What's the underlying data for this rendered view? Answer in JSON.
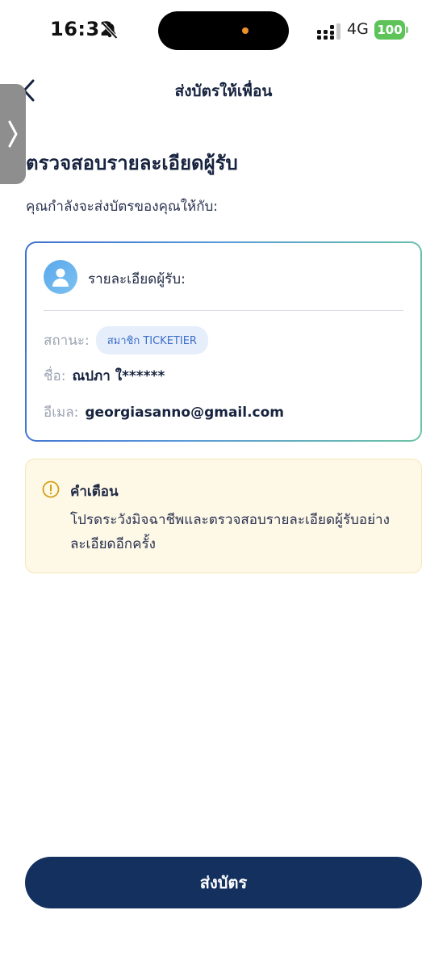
{
  "status_bar": {
    "time": "16:32",
    "network": "4G",
    "battery": "100",
    "icons": [
      "bell-muted-icon",
      "signal-icon",
      "battery-icon"
    ],
    "battery_color": "#5ec45a"
  },
  "header": {
    "title": "ส่งบัตรให้เพื่อน",
    "back_icon": "chevron-left-icon"
  },
  "side_handle": {
    "icon": "chevron-right-icon"
  },
  "main": {
    "heading": "ตรวจสอบรายละเอียดผู้รับ",
    "subtitle": "คุณกำลังจะส่งบัตรของคุณให้กับ:"
  },
  "recipient_card": {
    "title": "รายละเอียดผู้รับ:",
    "avatar_icon": "user-avatar-icon",
    "status_label": "สถานะ:",
    "status_badge": "สมาชิก TICKETIER",
    "name_label": "ชื่อ:",
    "name_value": "ณปภา ใ******",
    "email_label": "อีเมล:",
    "email_value": "georgiasanno@gmail.com",
    "border_gradient": [
      "#3d6fd0",
      "#6cc4a4"
    ]
  },
  "warning": {
    "icon": "warning-icon",
    "title": "คำเตือน",
    "text": "โปรดระวังมิจฉาชีพและตรวจสอบรายละเอียดผู้รับอย่างละเอียดอีกครั้ง",
    "background": "#fef8e7"
  },
  "actions": {
    "send_label": "ส่งบัตร",
    "primary_color": "#14305f"
  }
}
